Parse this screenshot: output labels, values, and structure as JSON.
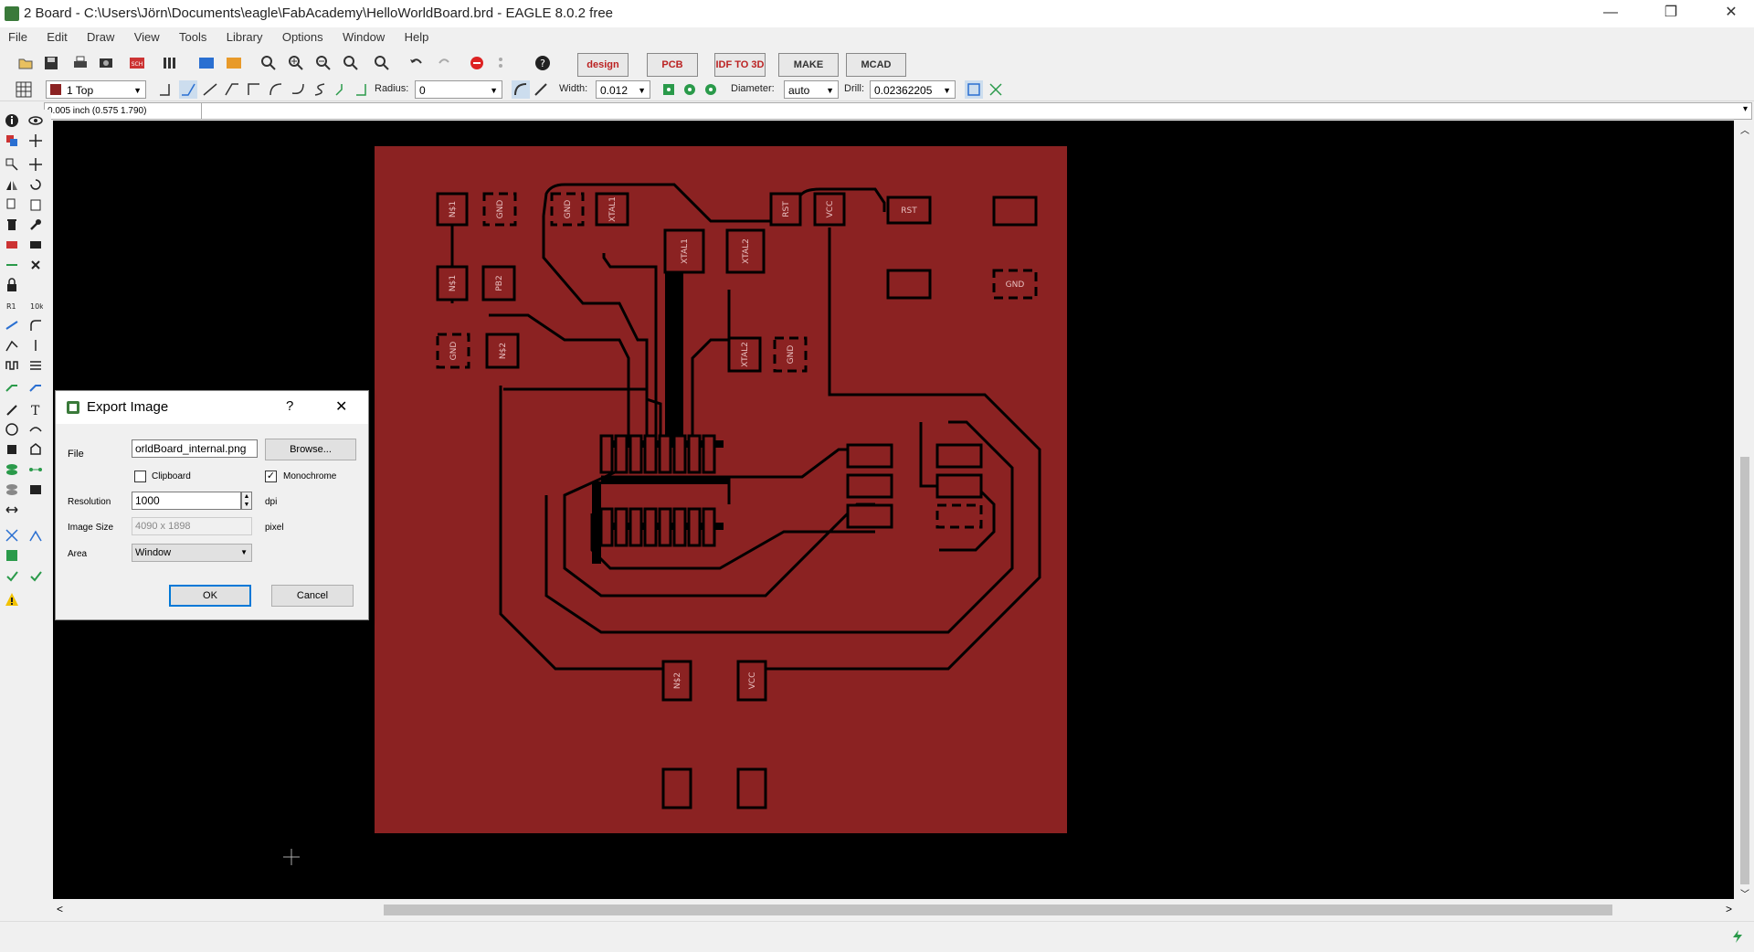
{
  "window": {
    "title": "2 Board - C:\\Users\\Jörn\\Documents\\eagle\\FabAcademy\\HelloWorldBoard.brd - EAGLE 8.0.2 free",
    "minimize": "—",
    "restore": "❐",
    "close": "✕"
  },
  "menu": [
    "File",
    "Edit",
    "Draw",
    "View",
    "Tools",
    "Library",
    "Options",
    "Window",
    "Help"
  ],
  "toolbar": {
    "design_link": "design link",
    "pcb_quote": "PCB QUOTE",
    "idf": "IDF TO 3D",
    "make": "MAKE",
    "mcad": "MCAD"
  },
  "toolbar2": {
    "layer": "1 Top",
    "radius_label": "Radius:",
    "radius_value": "0",
    "width_label": "Width:",
    "width_value": "0.012",
    "diameter_label": "Diameter:",
    "diameter_value": "auto",
    "drill_label": "Drill:",
    "drill_value": "0.02362205"
  },
  "coordinate_readout": "0.005 inch (0.575 1.790)",
  "colors": {
    "board": "#8b2222",
    "canvas": "#000000",
    "trace": "#000000",
    "accent": "#0078d7"
  },
  "pads": {
    "ne1": "N$1",
    "gnd1": "GND",
    "gnd2": "GND",
    "xtal1_top": "XTAL1",
    "rst1": "RST",
    "vcc1": "VCC",
    "rst2": "RST",
    "ne1b": "N$1",
    "pb2": "PB2",
    "xtal1": "XTAL1",
    "xtal2": "XTAL2",
    "gnd3": "GND",
    "gnd4": "GND",
    "ne2": "N$2",
    "xtal2b": "XTAL2",
    "gnd5": "GND",
    "ne2b": "N$2",
    "vcc2": "VCC"
  },
  "dialog": {
    "title": "Export Image",
    "help": "?",
    "close": "✕",
    "file_label": "File",
    "file_value": "orldBoard_internal.png",
    "browse": "Browse...",
    "clipboard_label": "Clipboard",
    "clipboard_checked": false,
    "monochrome_label": "Monochrome",
    "monochrome_checked": true,
    "resolution_label": "Resolution",
    "resolution_value": "1000",
    "resolution_unit": "dpi",
    "image_size_label": "Image Size",
    "image_size_value": "4090 x 1898",
    "image_size_unit": "pixel",
    "area_label": "Area",
    "area_value": "Window",
    "ok": "OK",
    "cancel": "Cancel"
  }
}
